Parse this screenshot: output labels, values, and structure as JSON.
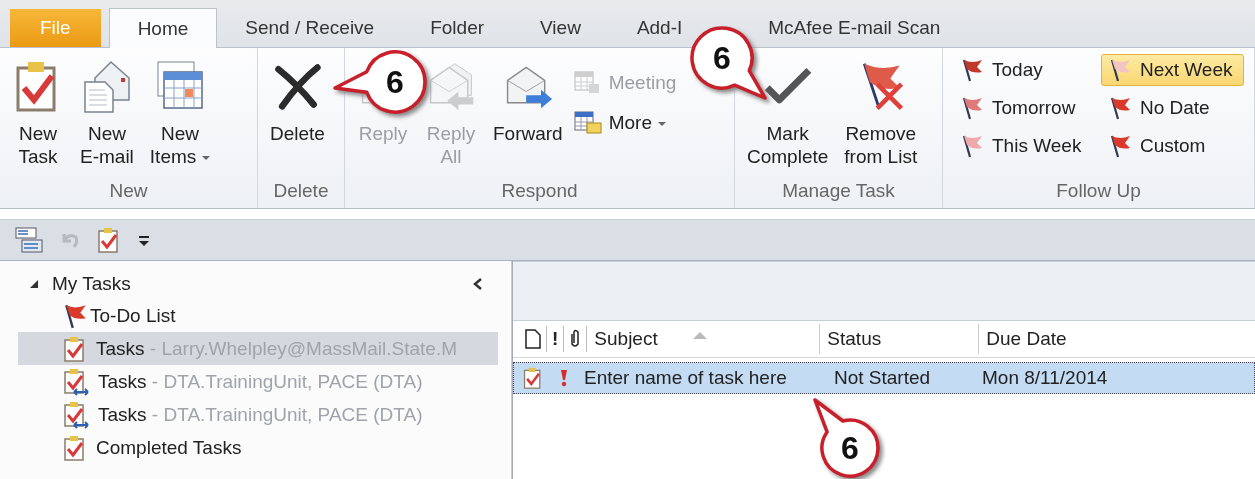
{
  "tabs": [
    {
      "label": "File",
      "kind": "file",
      "selected": false
    },
    {
      "label": "Home",
      "kind": "tab",
      "selected": true
    },
    {
      "label": "Send / Receive",
      "kind": "tab",
      "selected": false
    },
    {
      "label": "Folder",
      "kind": "tab",
      "selected": false
    },
    {
      "label": "View",
      "kind": "tab",
      "selected": false
    },
    {
      "label": "Add-I",
      "kind": "tab",
      "selected": false
    },
    {
      "label": "McAfee E-mail Scan",
      "kind": "tab",
      "selected": false
    }
  ],
  "ribbon_groups": [
    {
      "label": "New",
      "buttons": [
        {
          "label": "New\nTask",
          "kind": "large",
          "disabled": false,
          "dropdown": false
        },
        {
          "label": "New\nE-mail",
          "kind": "large",
          "disabled": false,
          "dropdown": false
        },
        {
          "label": "New\nItems",
          "kind": "large",
          "disabled": false,
          "dropdown": true
        }
      ]
    },
    {
      "label": "Delete",
      "buttons": [
        {
          "label": "Delete",
          "kind": "large",
          "disabled": false,
          "dropdown": false
        }
      ]
    },
    {
      "label": "Respond",
      "buttons": [
        {
          "label": "Reply",
          "kind": "large",
          "disabled": true,
          "dropdown": false
        },
        {
          "label": "Reply\nAll",
          "kind": "large",
          "disabled": true,
          "dropdown": false
        },
        {
          "label": "Forward",
          "kind": "large",
          "disabled": false,
          "dropdown": false
        },
        {
          "label": "Meeting",
          "kind": "small",
          "disabled": true,
          "dropdown": false
        },
        {
          "label": "More",
          "kind": "small",
          "disabled": false,
          "dropdown": true
        }
      ]
    },
    {
      "label": "Manage Task",
      "buttons": [
        {
          "label": "Mark\nComplete",
          "kind": "large",
          "disabled": false,
          "dropdown": false
        },
        {
          "label": "Remove\nfrom List",
          "kind": "large",
          "disabled": false,
          "dropdown": false
        }
      ]
    },
    {
      "label": "Follow Up",
      "buttons": [
        {
          "label": "Today",
          "kind": "flag",
          "color": "#c0392b",
          "selected": false
        },
        {
          "label": "Next Week",
          "kind": "flag",
          "color": "#f2c4c4",
          "selected": true
        },
        {
          "label": "Tomorrow",
          "kind": "flag",
          "color": "#e07a7a",
          "selected": false
        },
        {
          "label": "No Date",
          "kind": "flag",
          "color": "#d93a2b",
          "selected": false
        },
        {
          "label": "This Week",
          "kind": "flag",
          "color": "#f0a8a8",
          "selected": false
        },
        {
          "label": "Custom",
          "kind": "flag",
          "color": "#d93a2b",
          "selected": false
        }
      ]
    }
  ],
  "navigation": {
    "title": "My Tasks",
    "expanded": true,
    "items": [
      {
        "name": "To-Do List",
        "kind": "todo",
        "selected": false
      },
      {
        "name": "Tasks",
        "account": "- Larry.Whelpley@MassMail.State.M",
        "kind": "tasks",
        "selected": true
      },
      {
        "name": "Tasks",
        "account": "- DTA.TrainingUnit, PACE (DTA)",
        "kind": "shared",
        "selected": false
      },
      {
        "name": "Tasks",
        "account": "- DTA.TrainingUnit, PACE (DTA)",
        "kind": "shared",
        "selected": false
      },
      {
        "name": "Completed Tasks",
        "kind": "tasks",
        "selected": false
      }
    ]
  },
  "task_list": {
    "importance_header": "!",
    "columns": [
      "Subject",
      "Status",
      "Due Date"
    ],
    "rows": [
      {
        "subject": "Enter name of task here",
        "status": "Not Started",
        "due_date": "Mon 8/11/2014",
        "high_importance": true,
        "selected": true
      }
    ]
  },
  "callouts": [
    {
      "number": "6"
    },
    {
      "number": "6"
    },
    {
      "number": "6"
    }
  ]
}
